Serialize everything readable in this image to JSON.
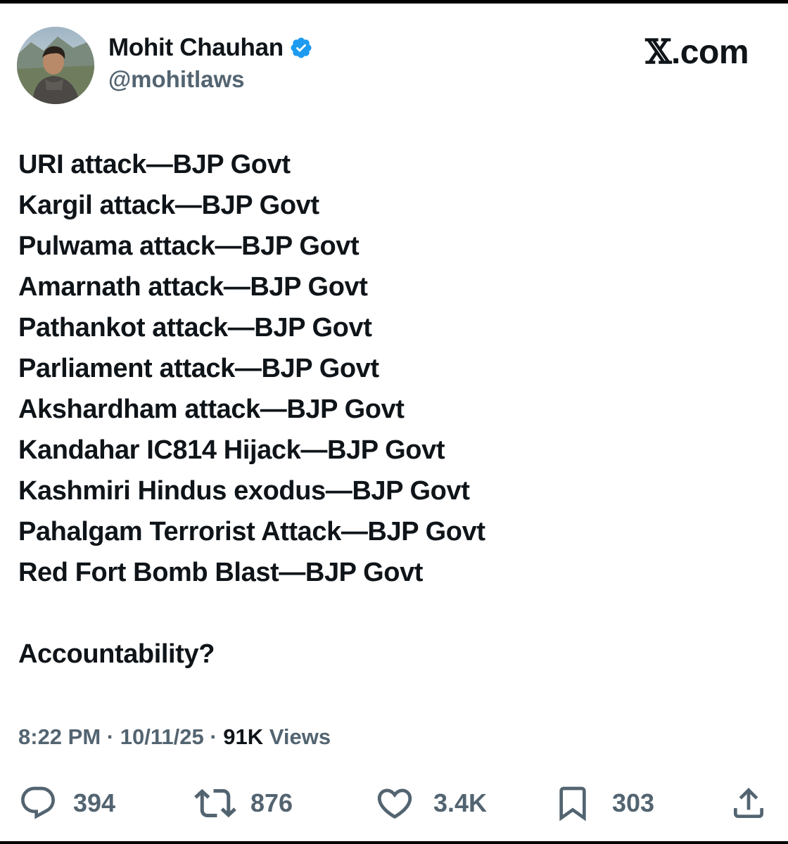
{
  "author": {
    "display_name": "Mohit Chauhan",
    "handle": "@mohitlaws",
    "verified_icon": "verified-badge-icon",
    "avatar_icon": "profile-photo"
  },
  "site_mark": {
    "x": "𝕏",
    "suffix": ".com"
  },
  "tweet": {
    "lines": [
      "URI attack—BJP Govt",
      "Kargil attack—BJP Govt",
      "Pulwama attack—BJP Govt",
      "Amarnath attack—BJP Govt",
      "Pathankot attack—BJP Govt",
      "Parliament attack—BJP Govt",
      "Akshardham attack—BJP Govt",
      "Kandahar IC814 Hijack—BJP Govt",
      "Kashmiri Hindus exodus—BJP Govt",
      "Pahalgam Terrorist Attack—BJP Govt",
      "Red Fort Bomb Blast—BJP Govt"
    ],
    "question": "Accountability?"
  },
  "meta": {
    "time": "8:22 PM",
    "separator": "·",
    "date": "10/11/25",
    "views_count": "91K",
    "views_label": "Views"
  },
  "actions": {
    "replies": "394",
    "reposts": "876",
    "likes": "3.4K",
    "bookmarks": "303"
  },
  "colors": {
    "text": "#0f1419",
    "secondary": "#536471",
    "verified": "#1d9bf0"
  }
}
